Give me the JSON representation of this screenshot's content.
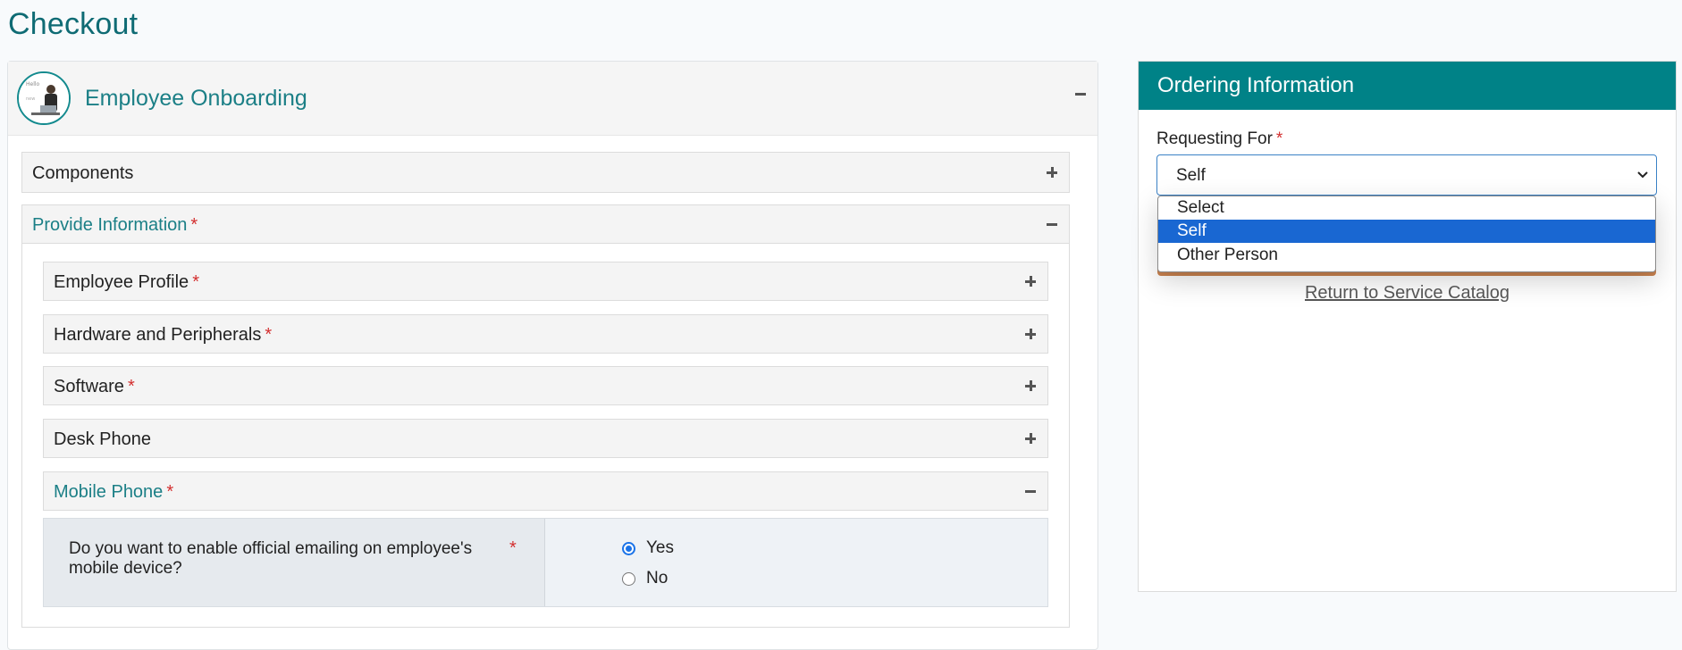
{
  "page": {
    "title": "Checkout"
  },
  "main": {
    "panel_title": "Employee Onboarding",
    "sections": {
      "components": "Components",
      "provide_information": "Provide Information"
    },
    "subsections": [
      {
        "label": "Employee Profile",
        "required": true
      },
      {
        "label": "Hardware and Peripherals",
        "required": true
      },
      {
        "label": "Software",
        "required": true
      },
      {
        "label": "Desk Phone",
        "required": false
      },
      {
        "label": "Mobile Phone",
        "required": true
      }
    ],
    "question": {
      "text": "Do you want to enable official emailing on employee's mobile device?",
      "options": [
        "Yes",
        "No"
      ],
      "selected": "Yes"
    },
    "required_marker": "*"
  },
  "ordering": {
    "title": "Ordering Information",
    "requesting_for_label": "Requesting For",
    "selected_value": "Self",
    "options": [
      "Select",
      "Self",
      "Other Person"
    ],
    "return_link": "Return to Service Catalog"
  },
  "colors": {
    "accent": "#008287",
    "title": "#0f6b74",
    "required": "#d32f2f",
    "selected_option": "#1967d2"
  },
  "icons": [
    "collapse-minus-icon",
    "expand-plus-icon",
    "chevron-down-icon",
    "radio-icon"
  ]
}
